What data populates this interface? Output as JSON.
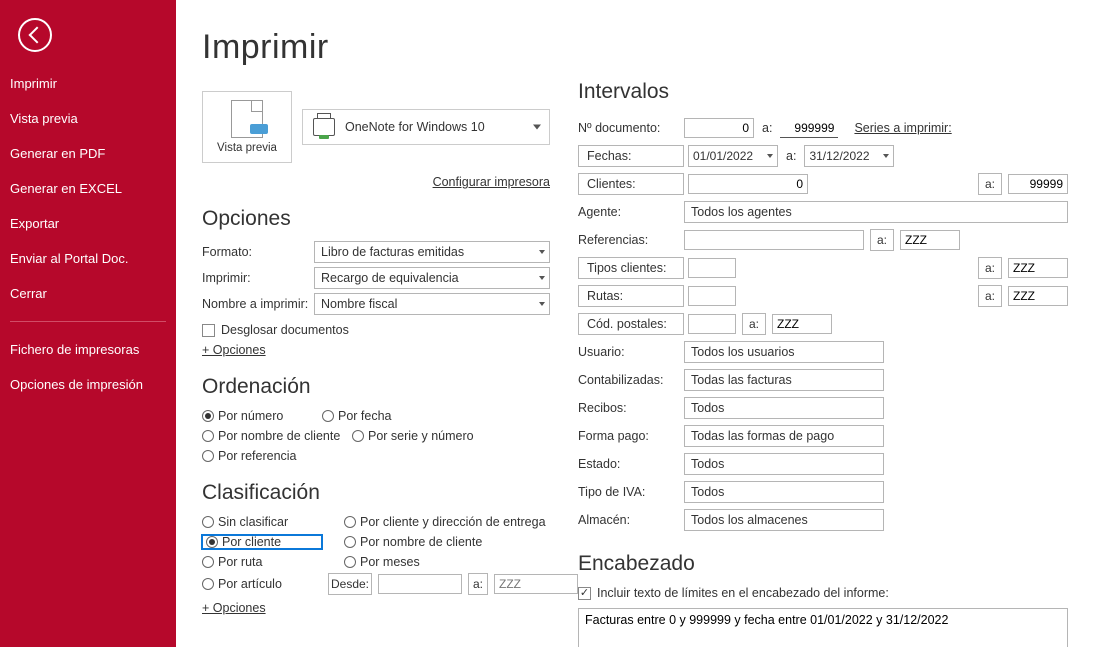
{
  "sidebar": {
    "items": [
      "Imprimir",
      "Vista previa",
      "Generar en PDF",
      "Generar en EXCEL",
      "Exportar",
      "Enviar al Portal Doc.",
      "Cerrar"
    ],
    "secondary": [
      "Fichero de impresoras",
      "Opciones de impresión"
    ]
  },
  "title": "Imprimir",
  "preview": {
    "label": "Vista previa",
    "printer": "OneNote for Windows 10",
    "config": "Configurar impresora"
  },
  "opciones": {
    "heading": "Opciones",
    "rows": {
      "formato_label": "Formato:",
      "formato_value": "Libro de facturas emitidas",
      "imprimir_label": "Imprimir:",
      "imprimir_value": "Recargo de equivalencia",
      "nombre_label": "Nombre a imprimir:",
      "nombre_value": "Nombre fiscal"
    },
    "desglosar": "Desglosar documentos",
    "mas": "+ Opciones"
  },
  "ordenacion": {
    "heading": "Ordenación",
    "items": [
      "Por número",
      "Por fecha",
      "Por nombre de cliente",
      "Por serie y número",
      "Por referencia"
    ],
    "selected": 0
  },
  "clasificacion": {
    "heading": "Clasificación",
    "left": [
      "Sin clasificar",
      "Por cliente",
      "Por ruta",
      "Por artículo"
    ],
    "right": [
      "Por cliente y dirección de entrega",
      "Por nombre de cliente",
      "Por meses"
    ],
    "selected_left": 1,
    "desde": "Desde:",
    "a": "a:",
    "zzz": "ZZZ",
    "mas": "+ Opciones"
  },
  "intervalos": {
    "heading": "Intervalos",
    "num_doc_label": "Nº documento:",
    "num_doc_from": "0",
    "num_doc_to": "999999",
    "a": "a:",
    "series": "Series a imprimir:",
    "fechas_btn": "Fechas:",
    "fecha_from": "01/01/2022",
    "fecha_to": "31/12/2022",
    "clientes_btn": "Clientes:",
    "clientes_from": "0",
    "clientes_to": "99999",
    "agente_label": "Agente:",
    "agente_value": "Todos los agentes",
    "ref_label": "Referencias:",
    "ref_to": "ZZZ",
    "tipos_btn": "Tipos clientes:",
    "tipos_to": "ZZZ",
    "rutas_btn": "Rutas:",
    "rutas_to": "ZZZ",
    "codp_btn": "Cód. postales:",
    "codp_to": "ZZZ",
    "usuario_label": "Usuario:",
    "usuario_value": "Todos los usuarios",
    "cont_label": "Contabilizadas:",
    "cont_value": "Todas las facturas",
    "recibos_label": "Recibos:",
    "recibos_value": "Todos",
    "forma_label": "Forma pago:",
    "forma_value": "Todas las formas de pago",
    "estado_label": "Estado:",
    "estado_value": "Todos",
    "iva_label": "Tipo de IVA:",
    "iva_value": "Todos",
    "almacen_label": "Almacén:",
    "almacen_value": "Todos los almacenes"
  },
  "encabezado": {
    "heading": "Encabezado",
    "chk": "Incluir texto de límites en el encabezado del informe:",
    "text": "Facturas entre 0 y 999999 y fecha entre 01/01/2022 y 31/12/2022"
  }
}
